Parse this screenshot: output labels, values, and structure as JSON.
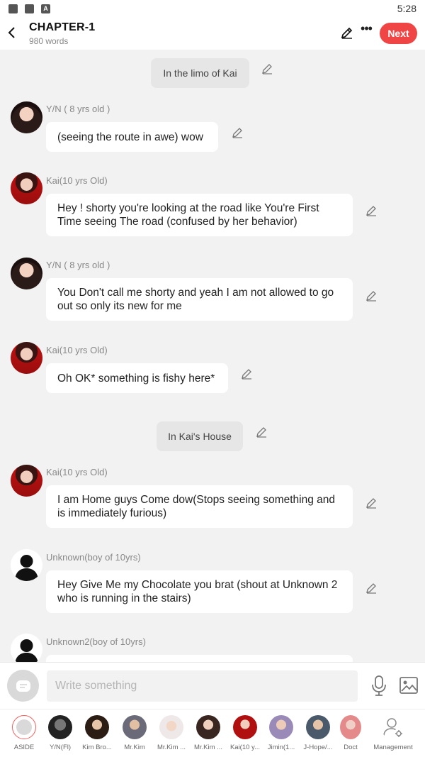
{
  "status_bar": {
    "time": "5:28",
    "icons": [
      "gallery-icon",
      "folder-icon",
      "app-a-icon"
    ],
    "letter": "A"
  },
  "header": {
    "title": "CHAPTER-1",
    "word_count": "980 words",
    "next_label": "Next"
  },
  "messages": {
    "aside1": "In the limo of Kai",
    "m1": {
      "name": "Y/N ( 8 yrs old )",
      "text": "(seeing the route in awe) wow"
    },
    "m2": {
      "name": "Kai(10 yrs Old)",
      "text": "Hey ! shorty you're looking at the road like You're First Time seeing The road (confused by her behavior)"
    },
    "m3": {
      "name": "Y/N ( 8 yrs old )",
      "text": "You Don't call me shorty and yeah I am not allowed to go out so only its new for me"
    },
    "m4": {
      "name": "Kai(10 yrs Old)",
      "text": "Oh OK* something is fishy here*"
    },
    "aside2": "In Kai's House",
    "m5": {
      "name": "Kai(10 yrs Old)",
      "text": "I am Home guys Come dow(Stops seeing something and is immediately furious)"
    },
    "m6": {
      "name": "Unknown(boy of 10yrs)",
      "text": "Hey Give Me my Chocolate you brat (shout at Unknown 2 who is running in the stairs)"
    },
    "m7": {
      "name": "Unknown2(boy of 10yrs)",
      "text": ""
    }
  },
  "composer": {
    "placeholder": "Write something"
  },
  "characters": [
    {
      "label": "ASIDE"
    },
    {
      "label": "Y/N(Fl)"
    },
    {
      "label": "Kim Bro..."
    },
    {
      "label": "Mr.Kim"
    },
    {
      "label": "Mr.Kim ..."
    },
    {
      "label": "Mr.Kim ..."
    },
    {
      "label": "Kai(10 y..."
    },
    {
      "label": "Jimin(1..."
    },
    {
      "label": "J-Hope/..."
    },
    {
      "label": "Doct"
    },
    {
      "label": "Management"
    }
  ],
  "colors": {
    "accent": "#f04545",
    "bubble": "#ffffff",
    "aside_bubble": "#e6e6e6",
    "background": "#f2f2f2"
  }
}
